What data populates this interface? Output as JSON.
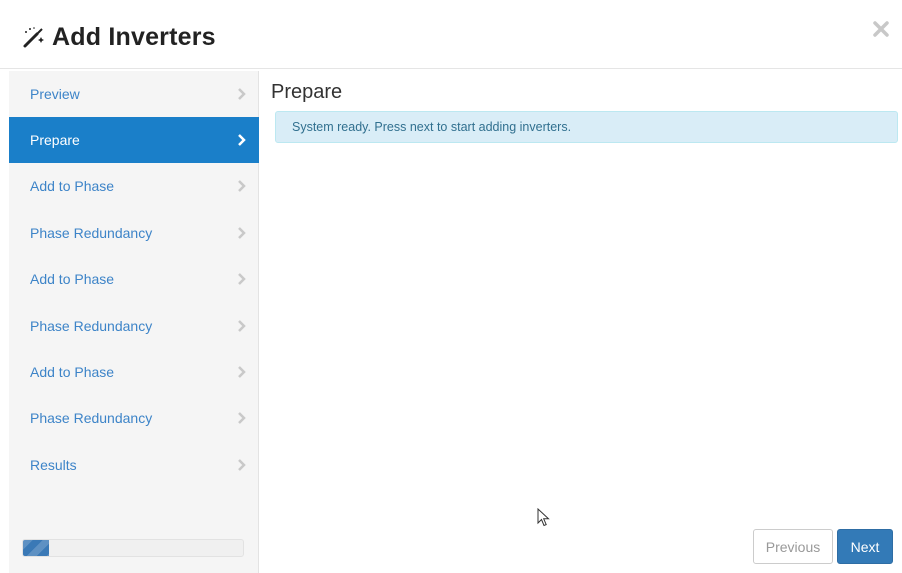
{
  "dialog": {
    "title": "Add Inverters",
    "title_icon": "magic-wand-icon",
    "close_icon": "close-icon"
  },
  "sidebar": {
    "items": [
      {
        "label": "Preview",
        "active": false
      },
      {
        "label": "Prepare",
        "active": true
      },
      {
        "label": "Add to Phase",
        "active": false
      },
      {
        "label": "Phase Redundancy",
        "active": false
      },
      {
        "label": "Add to Phase",
        "active": false
      },
      {
        "label": "Phase Redundancy",
        "active": false
      },
      {
        "label": "Add to Phase",
        "active": false
      },
      {
        "label": "Phase Redundancy",
        "active": false
      },
      {
        "label": "Results",
        "active": false
      }
    ],
    "progress_percent": 12
  },
  "main": {
    "section_title": "Prepare",
    "alert_text": "System ready. Press next to start adding inverters."
  },
  "footer": {
    "previous_label": "Previous",
    "next_label": "Next"
  },
  "colors": {
    "active_nav": "#1a7fc9",
    "link": "#3d84c8",
    "alert_bg": "#d9edf7",
    "alert_text": "#31708f",
    "primary_button": "#337ab7"
  }
}
